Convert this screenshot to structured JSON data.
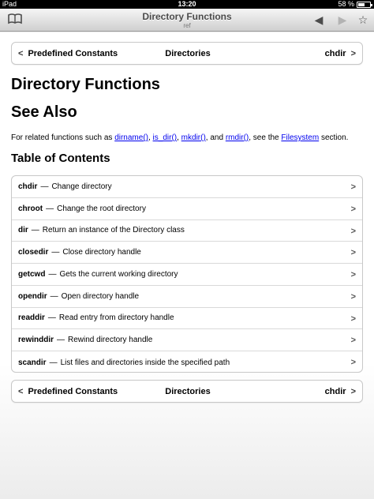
{
  "status_bar": {
    "device": "iPad",
    "time": "13:20",
    "battery": "58 %",
    "battery_level": 0.58
  },
  "navbar": {
    "title": "Directory Functions",
    "subtitle": "ref"
  },
  "pager_top": {
    "prev": "Predefined Constants",
    "current": "Directories",
    "next": "chdir"
  },
  "page": {
    "title": "Directory Functions",
    "see_also_heading": "See Also",
    "related": {
      "prefix": "For related functions such as ",
      "link1": "dirname()",
      "sep1": ", ",
      "link2": "is_dir()",
      "sep2": ", ",
      "link3": "mkdir()",
      "sep3": ", and ",
      "link4": "rmdir()",
      "mid": ", see the ",
      "link5": "Filesystem",
      "suffix": " section."
    },
    "toc_heading": "Table of Contents"
  },
  "toc": [
    {
      "name": "chdir",
      "dash": "—",
      "desc": "Change directory"
    },
    {
      "name": "chroot",
      "dash": "—",
      "desc": "Change the root directory"
    },
    {
      "name": "dir",
      "dash": "—",
      "desc": "Return an instance of the Directory class"
    },
    {
      "name": "closedir",
      "dash": "—",
      "desc": "Close directory handle"
    },
    {
      "name": "getcwd",
      "dash": "—",
      "desc": "Gets the current working directory"
    },
    {
      "name": "opendir",
      "dash": "—",
      "desc": "Open directory handle"
    },
    {
      "name": "readdir",
      "dash": "—",
      "desc": "Read entry from directory handle"
    },
    {
      "name": "rewinddir",
      "dash": "—",
      "desc": "Rewind directory handle"
    },
    {
      "name": "scandir",
      "dash": "—",
      "desc": "List files and directories inside the specified path"
    }
  ],
  "pager_bottom": {
    "prev": "Predefined Constants",
    "current": "Directories",
    "next": "chdir"
  },
  "colors": {
    "link": "#0000ee",
    "background": "#e9e9e9"
  }
}
